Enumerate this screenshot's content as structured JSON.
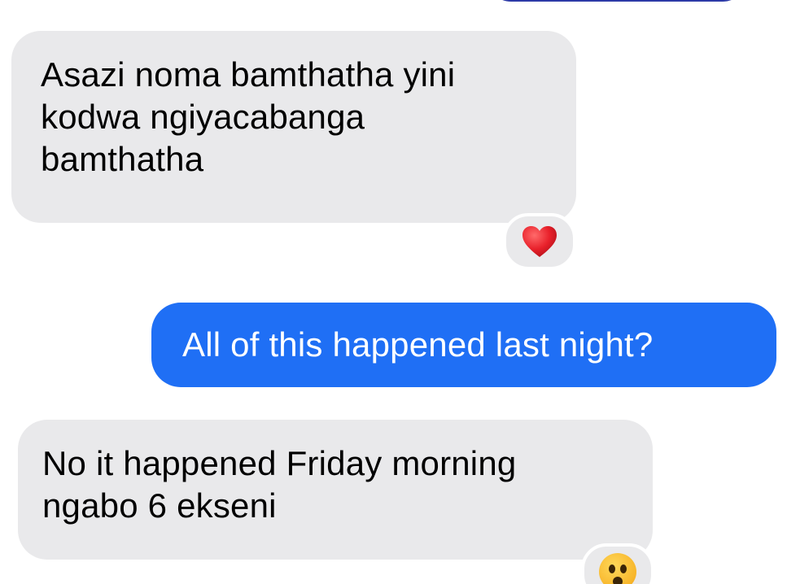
{
  "messages": [
    {
      "direction": "incoming",
      "lines": [
        "Asazi noma bamthatha yini",
        "kodwa ngiyacabanga",
        "bamthatha"
      ],
      "reaction": "red-heart"
    },
    {
      "direction": "outgoing",
      "text": "All of this happened last night?"
    },
    {
      "direction": "incoming",
      "lines": [
        "No it happened Friday morning",
        "ngabo 6 ekseni"
      ],
      "reaction": "hushed-face"
    }
  ],
  "colors": {
    "incoming_bubble": "#e9e9eb",
    "outgoing_bubble": "#1f6ff5",
    "incoming_text": "#000000",
    "outgoing_text": "#ffffff",
    "heart": "#e0202a"
  }
}
